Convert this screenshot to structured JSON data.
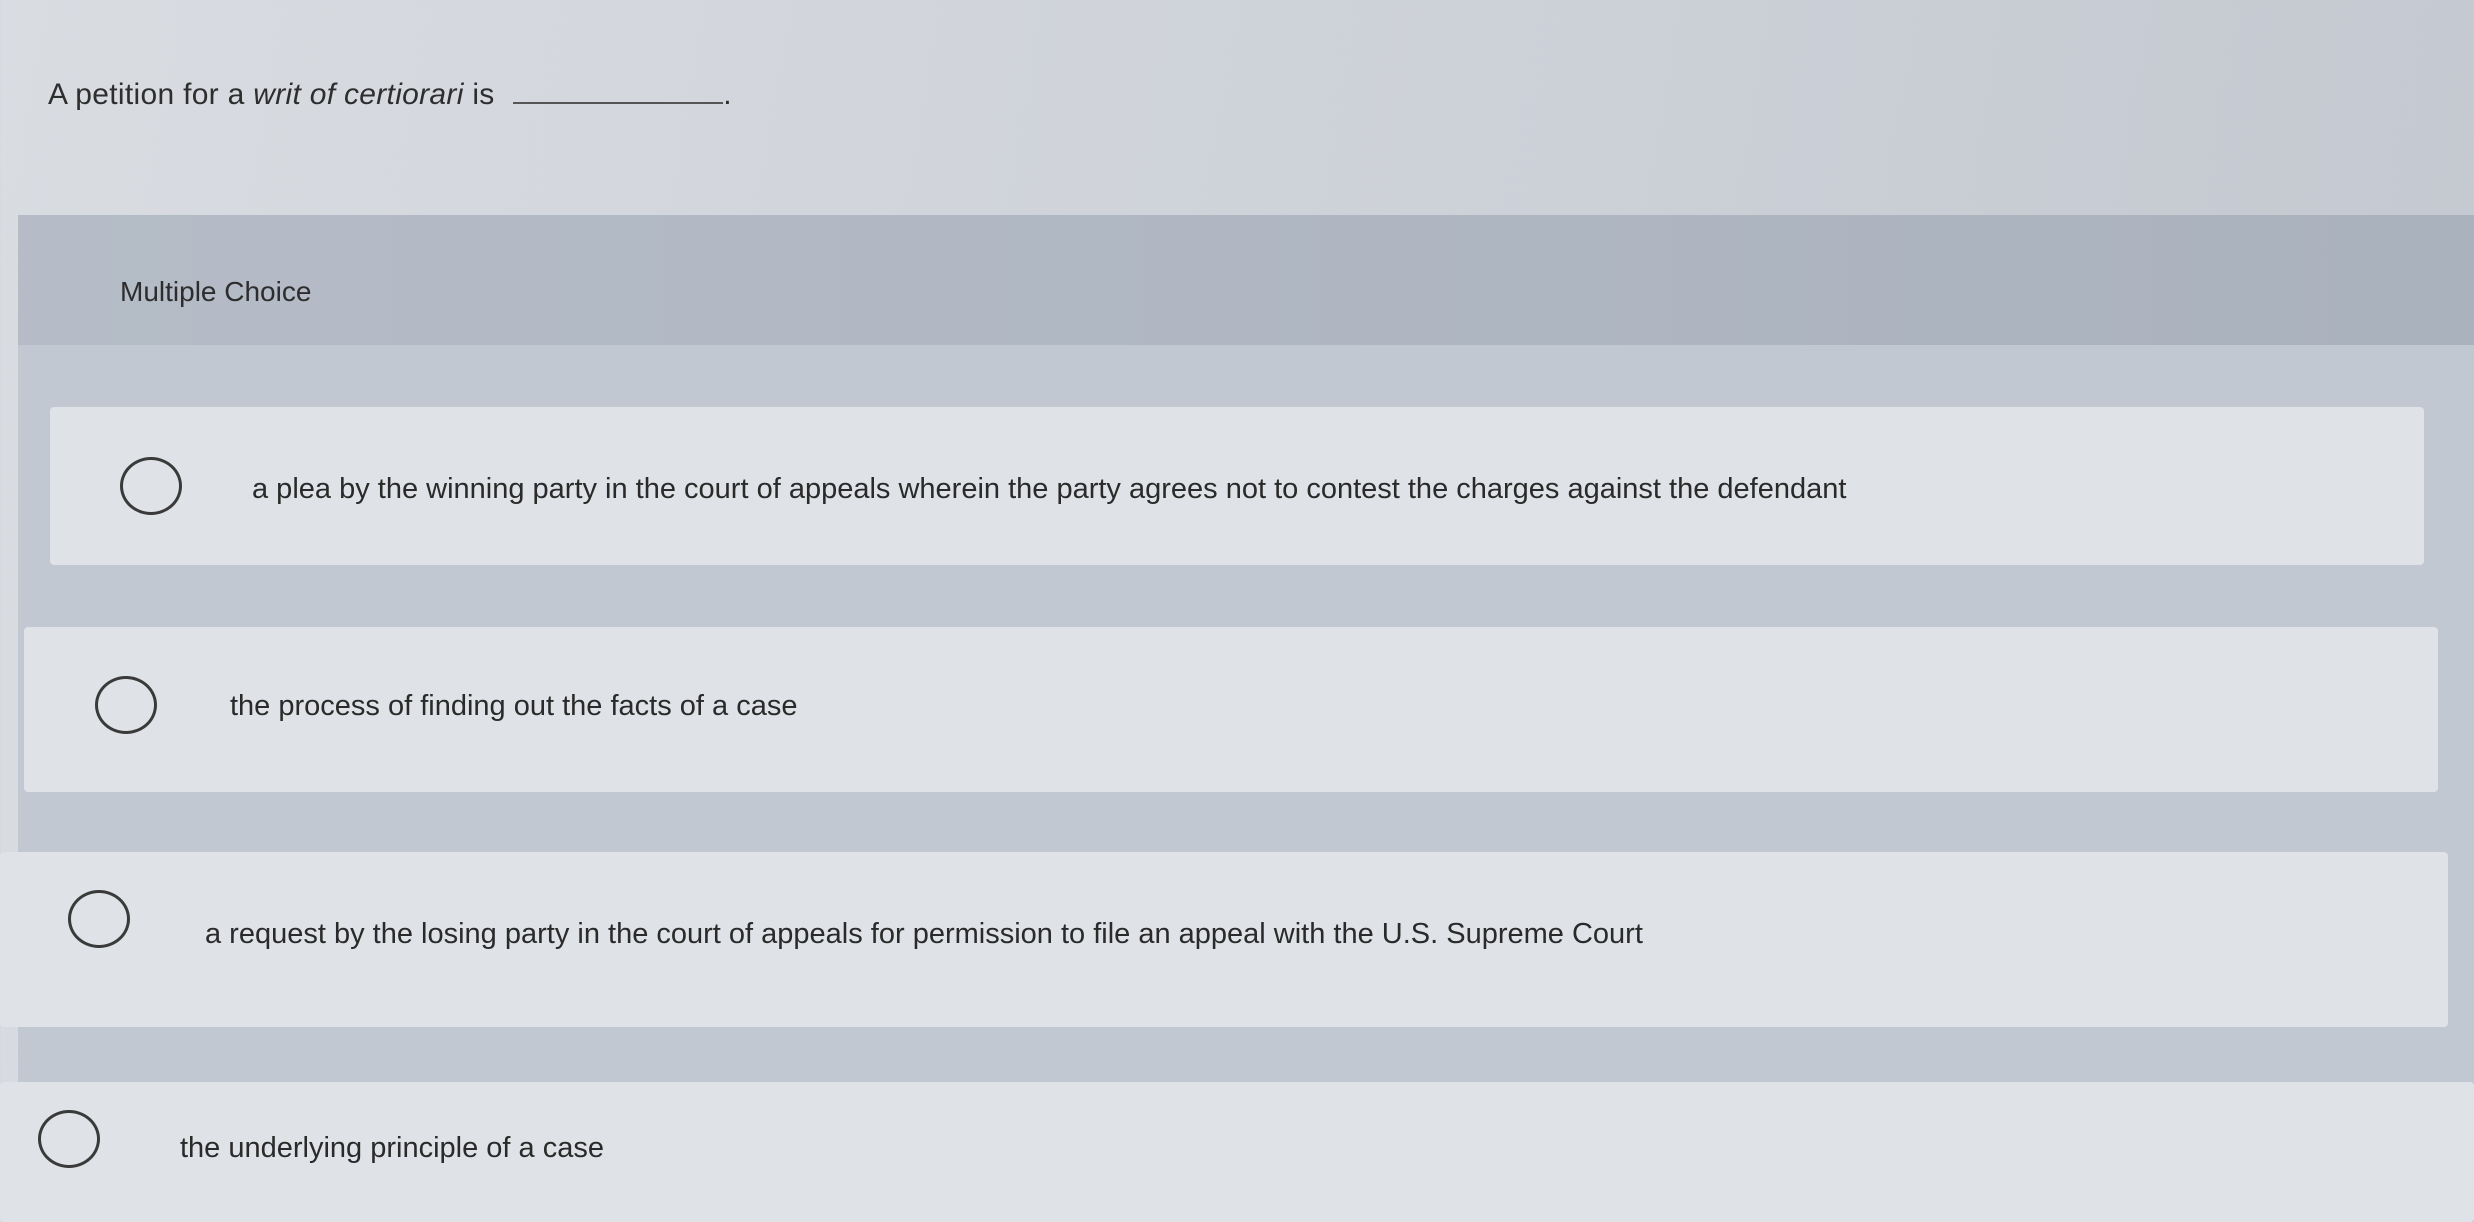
{
  "question": {
    "prefix": "A petition for a",
    "italic": "writ of certiorari",
    "suffix": "is",
    "end": "."
  },
  "section_label": "Multiple Choice",
  "options": [
    {
      "text": "a plea by the winning party in the court of appeals wherein the party agrees not to contest the charges against the defendant"
    },
    {
      "text": "the process of finding out the facts of a case"
    },
    {
      "text": "a request by the losing party in the court of appeals for permission to file an appeal with the U.S. Supreme Court"
    },
    {
      "text": "the underlying principle of a case"
    }
  ]
}
